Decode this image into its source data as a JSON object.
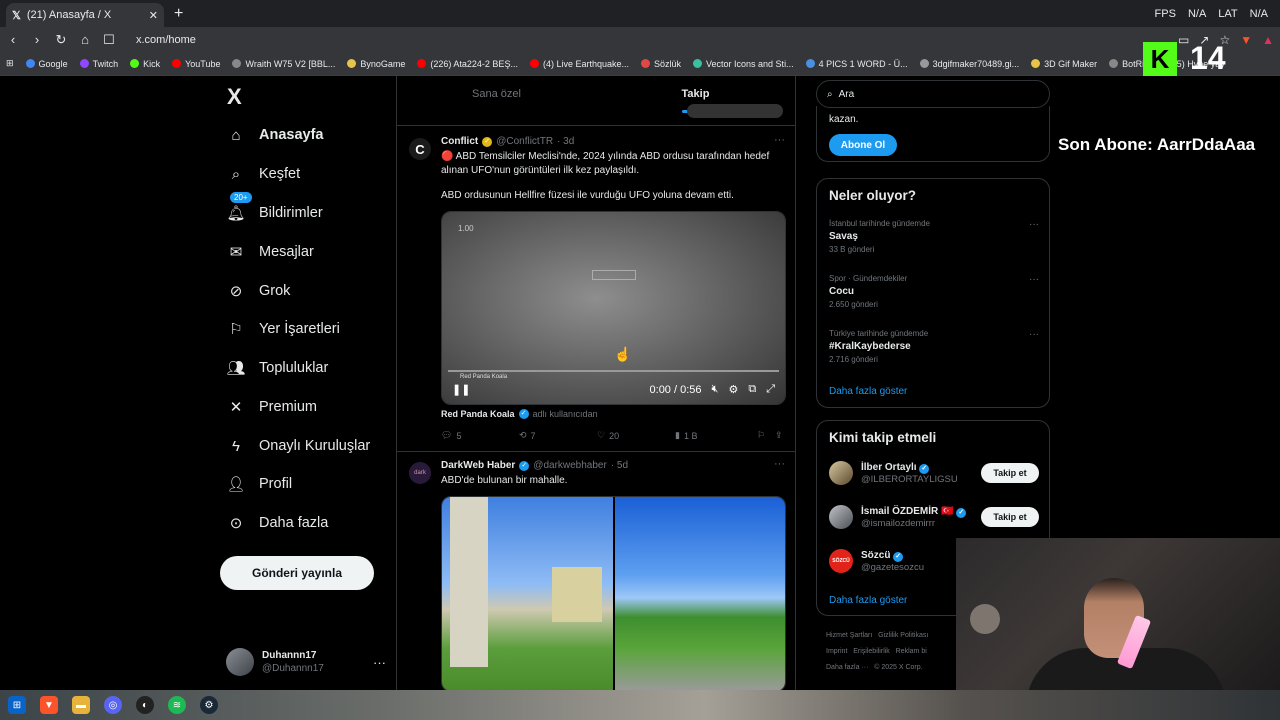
{
  "browser": {
    "tab_title": "(21) Anasayfa / X",
    "tab_right": [
      "FPS",
      "N/A",
      "LAT",
      "N/A"
    ],
    "url": "x.com/home",
    "bookmarks": [
      "Google",
      "Twitch",
      "Kick",
      "YouTube",
      "Wraith W75 V2 [BBL...",
      "BynoGame",
      "(226) Ata224-2 BEŞ...",
      "(4) Live Earthquake...",
      "Sözlük",
      "Vector Icons and Sti...",
      "4 PICS 1 WORD - Ü...",
      "3dgifmaker70489.gi...",
      "3D Gif Maker",
      "BotRix",
      "(5) Hype yay"
    ],
    "bookmark_colors": [
      "#4285f4",
      "#9146ff",
      "#53fc18",
      "#ff0000",
      "#888888",
      "#e7c34a",
      "#ff0000",
      "#ff0000",
      "#e04848",
      "#39c0a0",
      "#4a90e2",
      "#999999",
      "#e7c34a",
      "#888888",
      "#ff0000"
    ]
  },
  "nav": {
    "logo": "X",
    "items": [
      {
        "label": "Anasayfa",
        "icon": "home-icon",
        "bold": true
      },
      {
        "label": "Keşfet",
        "icon": "search-icon"
      },
      {
        "label": "Bildirimler",
        "icon": "bell-icon",
        "badge": "20+"
      },
      {
        "label": "Mesajlar",
        "icon": "mail-icon"
      },
      {
        "label": "Grok",
        "icon": "grok-icon"
      },
      {
        "label": "Yer İşaretleri",
        "icon": "bookmark-icon"
      },
      {
        "label": "Topluluklar",
        "icon": "people-icon"
      },
      {
        "label": "Premium",
        "icon": "x-icon"
      },
      {
        "label": "Onaylı Kuruluşlar",
        "icon": "lightning-icon"
      },
      {
        "label": "Profil",
        "icon": "user-icon"
      },
      {
        "label": "Daha fazla",
        "icon": "more-circle-icon"
      }
    ],
    "post_button": "Gönderi yayınla",
    "profile": {
      "name": "Duhannn17",
      "handle": "@Duhannn17"
    }
  },
  "feed": {
    "tabs": [
      "Sana özel",
      "Takip"
    ],
    "posts": [
      {
        "name": "Conflict",
        "handle": "@ConflictTR",
        "time": "· 3d",
        "text1": "🔴 ABD Temsilciler Meclisi'nde, 2024 yılında ABD ordusu tarafından hedef alınan UFO'nun görüntüleri ilk kez paylaşıldı.",
        "text2": "ABD ordusunun Hellfire füzesi ile vurduğu UFO yoluna devam etti.",
        "video_speed": "1.00",
        "video_time": "0:00 / 0:56",
        "video_watermark": "Red Panda Koala",
        "source_name": "Red Panda Koala",
        "source_suffix": "adlı kullanıcıdan",
        "replies": "5",
        "reposts": "7",
        "likes": "20",
        "views": "1 B"
      },
      {
        "name": "DarkWeb Haber",
        "handle": "@darkwebhaber",
        "time": "· 5d",
        "text1": "ABD'de bulunan bir mahalle."
      }
    ]
  },
  "sidebar": {
    "search_placeholder": "Ara",
    "sub_text": "kazan.",
    "sub_button": "Abone Ol",
    "trends_title": "Neler oluyor?",
    "trends": [
      {
        "context": "İstanbul tarihinde gündemde",
        "title": "Savaş",
        "count": "33 B gönderi"
      },
      {
        "context": "Spor · Gündemdekiler",
        "title": "Cocu",
        "count": "2.650 gönderi"
      },
      {
        "context": "Türkiye tarihinde gündemde",
        "title": "#KralKaybederse",
        "count": "2.716 gönderi"
      }
    ],
    "show_more": "Daha fazla göster",
    "who_title": "Kimi takip etmeli",
    "who": [
      {
        "name": "İlber Ortaylı",
        "handle": "@ILBERORTAYLIGSU",
        "follow": "Takip et"
      },
      {
        "name": "İsmail ÖZDEMİR 🇹🇷",
        "handle": "@ismailozdemirrr",
        "follow": "Takip et"
      },
      {
        "name": "Sözcü",
        "handle": "@gazetesozcu",
        "avatar_text": "SÖZCÜ"
      }
    ],
    "who_show_more": "Daha fazla göster",
    "footer": [
      "Hizmet Şartları",
      "Gizlilik Politikası",
      "Imprint",
      "Erişilebilirlik",
      "Reklam bi",
      "Daha fazla ···",
      "© 2025 X Corp."
    ]
  },
  "overlay": {
    "son_abone": "Son Abone: AarrDdaAaa",
    "kick_logo": "K",
    "kick_count": "14"
  }
}
